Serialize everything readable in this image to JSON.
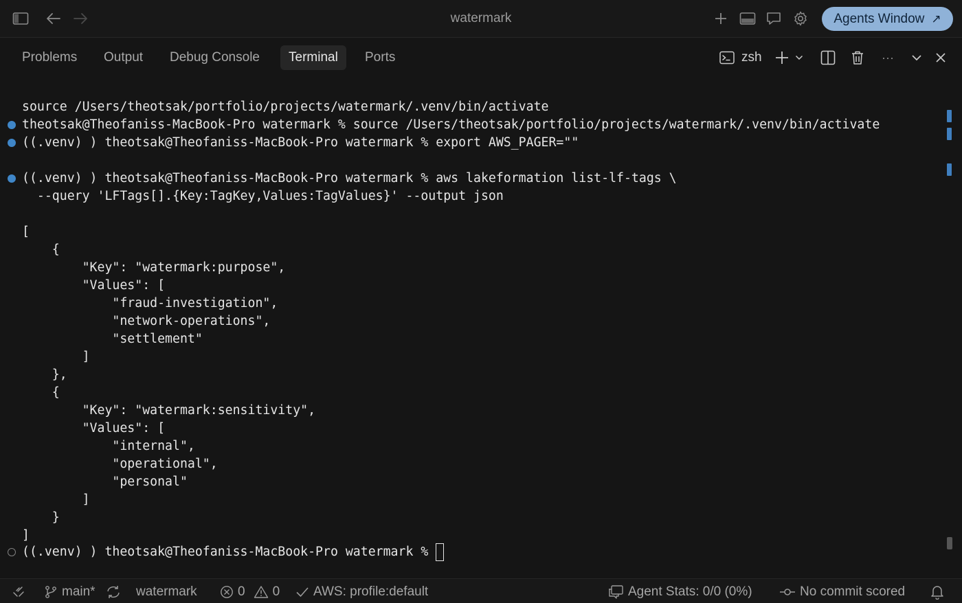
{
  "window": {
    "title": "watermark",
    "agents_button": "Agents Window",
    "agents_arrow": "↗"
  },
  "panel": {
    "tabs": [
      {
        "label": "Problems",
        "active": false
      },
      {
        "label": "Output",
        "active": false
      },
      {
        "label": "Debug Console",
        "active": false
      },
      {
        "label": "Terminal",
        "active": true
      },
      {
        "label": "Ports",
        "active": false
      }
    ],
    "shell": "zsh",
    "more": "···"
  },
  "terminal": {
    "lines": [
      "source /Users/theotsak/portfolio/projects/watermark/.venv/bin/activate",
      "theotsak@Theofaniss-MacBook-Pro watermark % source /Users/theotsak/portfolio/projects/watermark/.venv/bin/activate",
      "((.venv) ) theotsak@Theofaniss-MacBook-Pro watermark % export AWS_PAGER=\"\"",
      "",
      "((.venv) ) theotsak@Theofaniss-MacBook-Pro watermark % aws lakeformation list-lf-tags \\",
      "  --query 'LFTags[].{Key:TagKey,Values:TagValues}' --output json",
      "",
      "[",
      "    {",
      "        \"Key\": \"watermark:purpose\",",
      "        \"Values\": [",
      "            \"fraud-investigation\",",
      "            \"network-operations\",",
      "            \"settlement\"",
      "        ]",
      "    },",
      "    {",
      "        \"Key\": \"watermark:sensitivity\",",
      "        \"Values\": [",
      "            \"internal\",",
      "            \"operational\",",
      "            \"personal\"",
      "        ]",
      "    }",
      "]",
      "((.venv) ) theotsak@Theofaniss-MacBook-Pro watermark % "
    ]
  },
  "status": {
    "branch": "main*",
    "folder": "watermark",
    "errors": "0",
    "warnings": "0",
    "aws": "AWS: profile:default",
    "agent_stats": "Agent Stats: 0/0 (0%)",
    "commit": "No commit scored"
  },
  "colors": {
    "accent_dot": "#3f86c8",
    "agents_button_bg": "#8fb2d8",
    "background": "#151515"
  }
}
